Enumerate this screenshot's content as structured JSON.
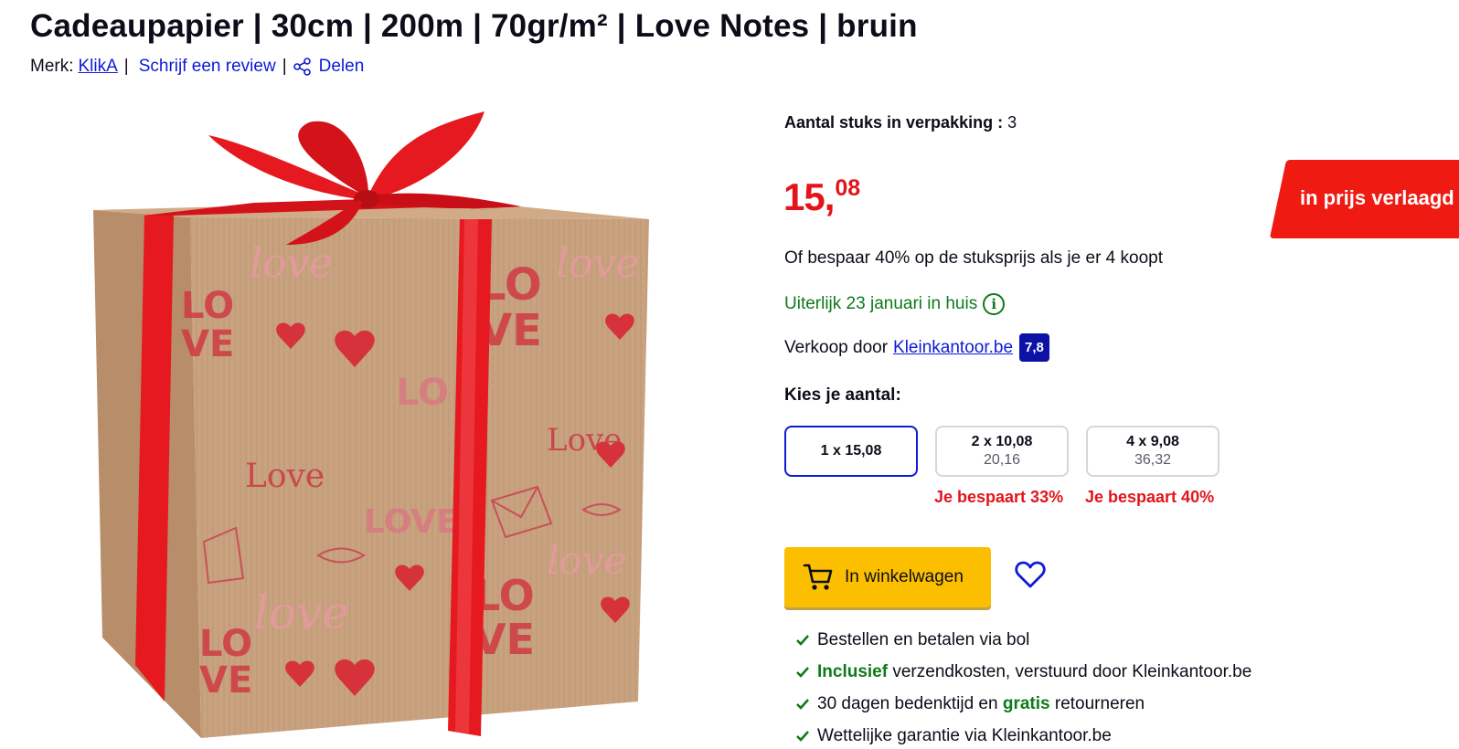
{
  "product": {
    "title": "Cadeaupapier | 30cm | 200m | 70gr/m² | Love Notes | bruin",
    "brand_label": "Merk:",
    "brand": "KlikA",
    "separator": "|",
    "review_link": "Schrijf een review",
    "share_link": "Delen",
    "image_alt": "Cadeau ingepakt in bruin cadeaupapier met Love Notes print en rood lint"
  },
  "offer": {
    "pack_label": "Aantal stuks in verpakking :",
    "pack_value": "3",
    "price_main": "15,",
    "price_cents": "08",
    "badge": "in prijs verlaagd",
    "save_note": "Of bespaar 40% op de stuksprijs als je er 4 koopt",
    "delivery": "Uiterlijk 23 januari in huis",
    "info_icon": "i",
    "seller_label": "Verkoop door",
    "seller_name": "Kleinkantoor.be",
    "seller_rating": "7,8"
  },
  "quantity": {
    "label": "Kies je aantal:",
    "options": [
      {
        "line1": "1 x 15,08",
        "line2": "",
        "saving": ""
      },
      {
        "line1": "2 x 10,08",
        "line2": "20,16",
        "saving": "Je bespaart 33%"
      },
      {
        "line1": "4 x 9,08",
        "line2": "36,32",
        "saving": "Je bespaart 40%"
      }
    ]
  },
  "actions": {
    "cart_label": "In winkelwagen"
  },
  "usps": [
    {
      "pre": "Bestellen en betalen via bol",
      "green": "",
      "post": ""
    },
    {
      "pre": "",
      "green": "Inclusief",
      "post": " verzendkosten, verstuurd door Kleinkantoor.be"
    },
    {
      "pre": "30 dagen bedenktijd en ",
      "green": "gratis",
      "post": " retourneren"
    },
    {
      "pre": "Wettelijke garantie via Kleinkantoor.be",
      "green": "",
      "post": ""
    }
  ],
  "colors": {
    "price_red": "#e4141b",
    "link_blue": "#0d1bd6",
    "cart_yellow": "#fcbf00",
    "delivery_green": "#0e7a1a",
    "rating_navy": "#0c12a6"
  },
  "icons": [
    "share-icon",
    "info-icon",
    "cart-icon",
    "heart-icon",
    "check-icon"
  ]
}
